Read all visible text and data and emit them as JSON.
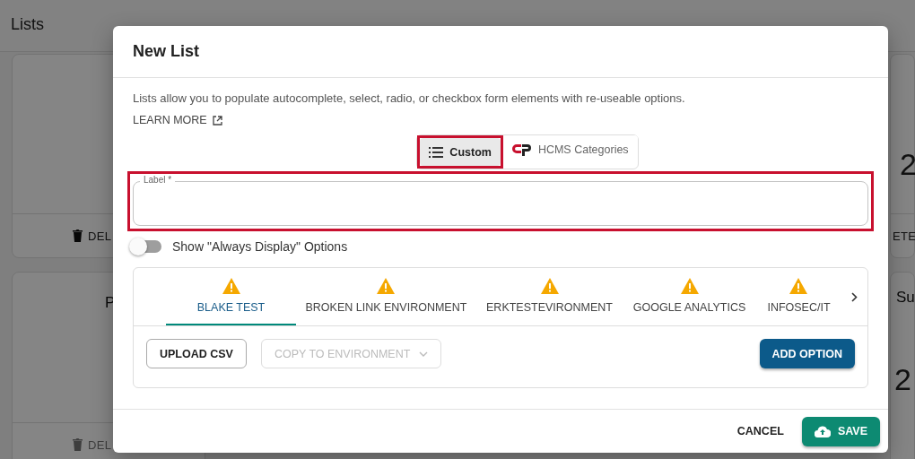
{
  "background": {
    "title": "Lists",
    "left_cards": [
      {
        "action": "DEL"
      },
      {
        "title": "P",
        "action": "DEL"
      }
    ],
    "right_cards": [
      {
        "count": "2",
        "action": "ETE"
      },
      {
        "title": "Su",
        "count": "2"
      }
    ]
  },
  "dialog": {
    "title": "New List",
    "description": "Lists allow you to populate autocomplete, select, radio, or checkbox form elements with re-useable options.",
    "learn_more": "LEARN MORE",
    "source_toggle": [
      {
        "label": "Custom",
        "kind": "list",
        "selected": true
      },
      {
        "label": "HCMS Categories",
        "kind": "brand",
        "selected": false
      }
    ],
    "label_field": {
      "label": "Label *"
    },
    "always_display": {
      "label": "Show \"Always Display\" Options",
      "on": false
    },
    "environments": [
      {
        "label": "BLAKE TEST",
        "warning": true,
        "selected": true
      },
      {
        "label": "BROKEN LINK ENVIRONMENT",
        "warning": true,
        "selected": false
      },
      {
        "label": "ERKTESTEVIRONMENT",
        "warning": true,
        "selected": false
      },
      {
        "label": "GOOGLE ANALYTICS",
        "warning": true,
        "selected": false
      },
      {
        "label": "INFOSEC/IT",
        "warning": true,
        "selected": false
      }
    ],
    "upload_button": "UPLOAD CSV",
    "copy_select": {
      "placeholder": "COPY TO ENVIRONMENT",
      "disabled": true
    },
    "add_button": "ADD OPTION",
    "cancel_button": "CANCEL",
    "save_button": "SAVE"
  }
}
